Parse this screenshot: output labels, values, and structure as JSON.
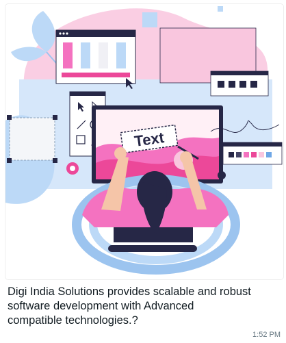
{
  "message": {
    "caption": "Digi India Solutions provides scalable and robust\nsoftware development with Advanced\ncompatible technologies.?",
    "time": "1:52 PM"
  },
  "illustration": {
    "screen_text": "Text",
    "colors": {
      "pink": "#f472c0",
      "hot_pink": "#ec4899",
      "light_pink": "#f9c6de",
      "light_blue": "#bcd9f7",
      "blue": "#6fa7e6",
      "navy": "#262746",
      "skin": "#f5c5a8",
      "cream": "#fff6f9"
    },
    "palette_swatches": [
      "#262746",
      "#444466",
      "#f472c0",
      "#ec4899",
      "#f9c6de",
      "#6fa7e6"
    ]
  }
}
